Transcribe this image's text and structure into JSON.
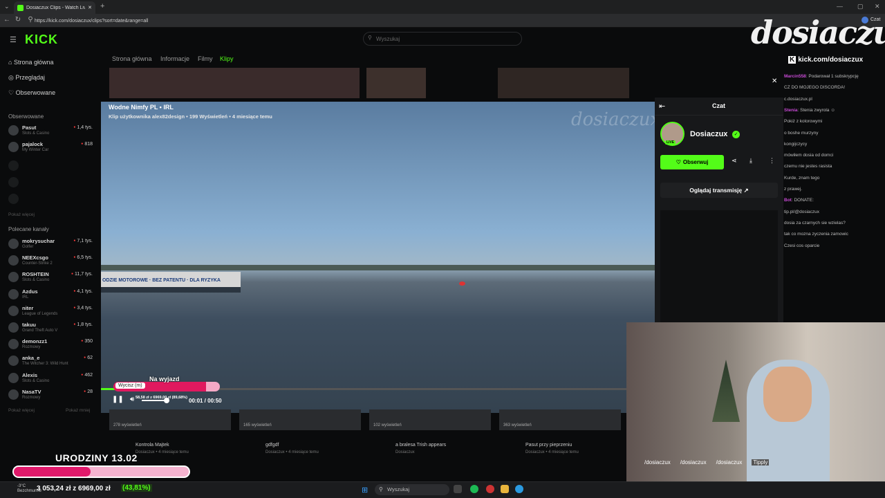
{
  "browser": {
    "tab_title": "Dosiaczux Clips - Watch Live",
    "url": "https://kick.com/dosiaczux/clips?sort=date&range=all",
    "profile_label": "Czat"
  },
  "kick": {
    "logo": "KICK",
    "search_placeholder": "Wyszukaj",
    "nav": [
      "Strona główna",
      "Przeglądaj",
      "Obserwowane"
    ],
    "followed_header": "Obserwowane",
    "followed": [
      {
        "name": "Pasut",
        "game": "Slots & Casino",
        "viewers": "1,4 tys."
      },
      {
        "name": "pajalock",
        "game": "My Winter Car",
        "viewers": "818"
      }
    ],
    "show_more": "Pokaż więcej",
    "recommended_header": "Polecane kanały",
    "recommended": [
      {
        "name": "mokrysuchar",
        "game": "Golfer",
        "viewers": "7,1 tys."
      },
      {
        "name": "NEEXcsgo",
        "game": "Counter-Strike 2",
        "viewers": "6,5 tys."
      },
      {
        "name": "ROSHTEIN",
        "game": "Slots & Casino",
        "viewers": "11,7 tys."
      },
      {
        "name": "Azdus",
        "game": "IRL",
        "viewers": "4,1 tys."
      },
      {
        "name": "niter",
        "game": "League of Legends",
        "viewers": "3,4 tys."
      },
      {
        "name": "takuu",
        "game": "Grand Theft Auto V",
        "viewers": "1,8 tys."
      },
      {
        "name": "demonzz1",
        "game": "Rozmowy",
        "viewers": "350"
      },
      {
        "name": "anka_e",
        "game": "The Witcher 3: Wild Hunt",
        "viewers": "62"
      },
      {
        "name": "Alexis",
        "game": "Slots & Casino",
        "viewers": "462"
      },
      {
        "name": "NasaTV",
        "game": "Rozmowy",
        "viewers": "28"
      }
    ],
    "show_more2": "Pokaż więcej",
    "show_less": "Pokaż mniej",
    "tabs": [
      "Strona główna",
      "Informacje",
      "Filmy",
      "Klipy"
    ]
  },
  "video": {
    "title": "Wodne Nimfy PL • IRL",
    "subtitle": "Klip użytkownika alex82design • 199 Wyświetleń • 4 miesiące temu",
    "watermark": "dosiaczux",
    "pier_sign": "ODZIE MOTOROWE · BEZ PATENTU · DLA RYZYKA",
    "time": "00:01 / 00:50",
    "mute_tooltip": "Wycisz (m)",
    "goal_title": "Na wyjazd",
    "goal_line": "58,58 zł z 6969,00 zł (89,68%)",
    "progress": 0.04
  },
  "cards": [
    {
      "views": "278 wyświetleń",
      "title": "Kontrola Majtek",
      "meta": "Dosiaczux • 4 miesiące temu"
    },
    {
      "views": "165 wyświetleń",
      "title": "gdfgdf",
      "meta": "Dosiaczux • 4 miesiące temu"
    },
    {
      "views": "102 wyświetleń",
      "title": "a bralesa Trish appears",
      "meta": "Dosiaczux"
    },
    {
      "views": "363 wyświetleń",
      "title": "Pasut przy pieprzeniu",
      "meta": "Dosiaczux • 4 miesiące temu"
    }
  ],
  "chat": {
    "title": "Czat",
    "streamer": "Dosiaczux",
    "live_badge": "LIVE",
    "follow": "Obserwuj",
    "watch": "Oglądaj transmisję ↗"
  },
  "feed": [
    {
      "user": "Marcin558",
      "text": "Podarował 1 subskrypcję"
    },
    {
      "user": "",
      "text": "CZ DO MOJEGO DISCORDA!"
    },
    {
      "user": "",
      "text": "c.dosiaczux.pl"
    },
    {
      "user": "Stenia",
      "text": "Stenia zwyrola ☺"
    },
    {
      "user": "",
      "text": "Pokiż z kolorowymi"
    },
    {
      "user": "",
      "text": "o boshe murzyny"
    },
    {
      "user": "",
      "text": "kongijczycy"
    },
    {
      "user": "",
      "text": "mówiłem dosia od domci"
    },
    {
      "user": "",
      "text": "czemu nie jestes rasista"
    },
    {
      "user": "",
      "text": "Kurde, znam tego"
    },
    {
      "user": "",
      "text": "z prawej."
    },
    {
      "user": "Bot",
      "text": "DONATE:"
    },
    {
      "user": "",
      "text": "tip.pl/@dosiaczux"
    },
    {
      "user": "",
      "text": "dosia za czarnych sie wzielas?"
    },
    {
      "user": "",
      "text": "tak co mozna zyczenia zamowic"
    },
    {
      "user": "",
      "text": "Czesi cos oparcie"
    }
  ],
  "overlay": {
    "brand": "dosiaczux",
    "brand_url": "kick.com/dosiaczux",
    "socials": [
      "/dosiaczux",
      "/dosiaczux",
      "/dosiaczux",
      "Tipply"
    ],
    "bday_title": "URODZINY 13.02",
    "bday_amount": "3 053,24 zł z 6969,00 zł",
    "bday_pct": "(43,81%)",
    "bday_progress": 0.4381
  },
  "taskbar": {
    "weather_temp": "-3°C",
    "weather_text": "Bezchmurnie",
    "search": "Wyszukaj"
  }
}
